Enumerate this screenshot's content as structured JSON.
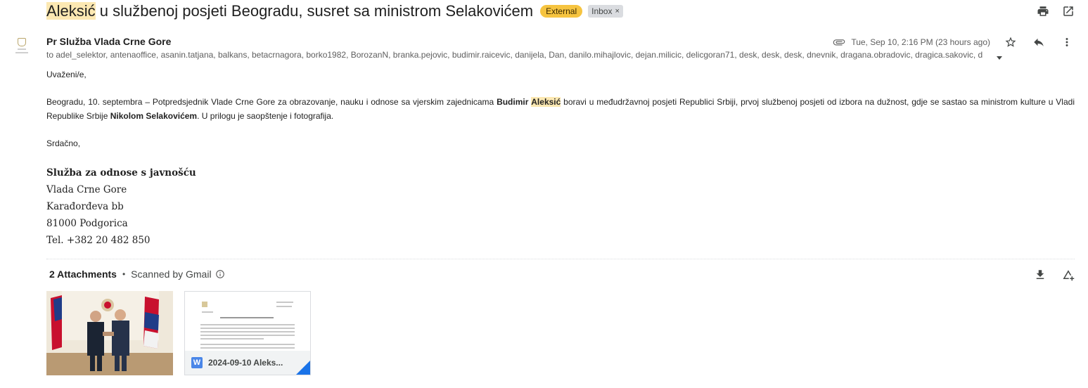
{
  "subject": {
    "highlight": "Aleksić",
    "rest": " u službenoj posjeti Beogradu, susret sa ministrom Selakovićem",
    "label_external": "External",
    "label_inbox": "Inbox",
    "label_remove": "×"
  },
  "sender": {
    "name": "Pr Služba Vlada Crne Gore",
    "datetime": "Tue, Sep 10, 2:16 PM (23 hours ago)",
    "recipients": "to adel_selektor, antenaoffice, asanin.tatjana, balkans, betacrnagora, borko1982, BorozanN, branka.pejovic, budimir.raicevic, danijela, Dan, danilo.mihajlovic, dejan.milicic, delicgoran71, desk, desk, desk, dnevnik, dragana.obradovic, dragica.sakovic, d"
  },
  "body": {
    "greeting": "Uvaženi/e,",
    "para_1": "Beogradu, 10. septembra – Potpredsjednik Vlade Crne Gore za obrazovanje, nauku i odnose sa vjerskim zajednicama ",
    "bold_first": "Budimir",
    "space": " ",
    "bold_highlight": "Aleksić",
    "para_2": " boravi u međudržavnoj posjeti Republici Srbiji, prvoj službenoj posjeti od izbora na dužnost, gdje se sastao sa ministrom kulture u Vladi Republike Srbije ",
    "bold_name": "Nikolom Selakovićem",
    "para_3": ". U prilogu je saopštenje i fotografija.",
    "closing": "Srdačno,"
  },
  "signature": {
    "name": "Služba za odnose s javnošću",
    "line1": "Vlada Crne Gore",
    "line2": "Karađorđeva bb",
    "line3": "81000 Podgorica",
    "line4": "Tel. +382 20 482 850"
  },
  "attachments": {
    "count_label": "2 Attachments",
    "separator": "•",
    "scanned_label": "Scanned by Gmail",
    "doc_letter": "W",
    "doc_name": "2024-09-10 Aleks..."
  },
  "icons": {
    "print": "print-icon",
    "open_new": "open-in-new-window-icon",
    "attachment": "paperclip-icon",
    "star": "star-icon",
    "reply": "reply-icon",
    "more": "more-vert-icon",
    "download": "download-icon",
    "drive": "add-to-drive-icon"
  },
  "colors": {
    "external_badge": "#f6c440",
    "highlight": "#fce8b2",
    "word_blue": "#4a86e8"
  }
}
